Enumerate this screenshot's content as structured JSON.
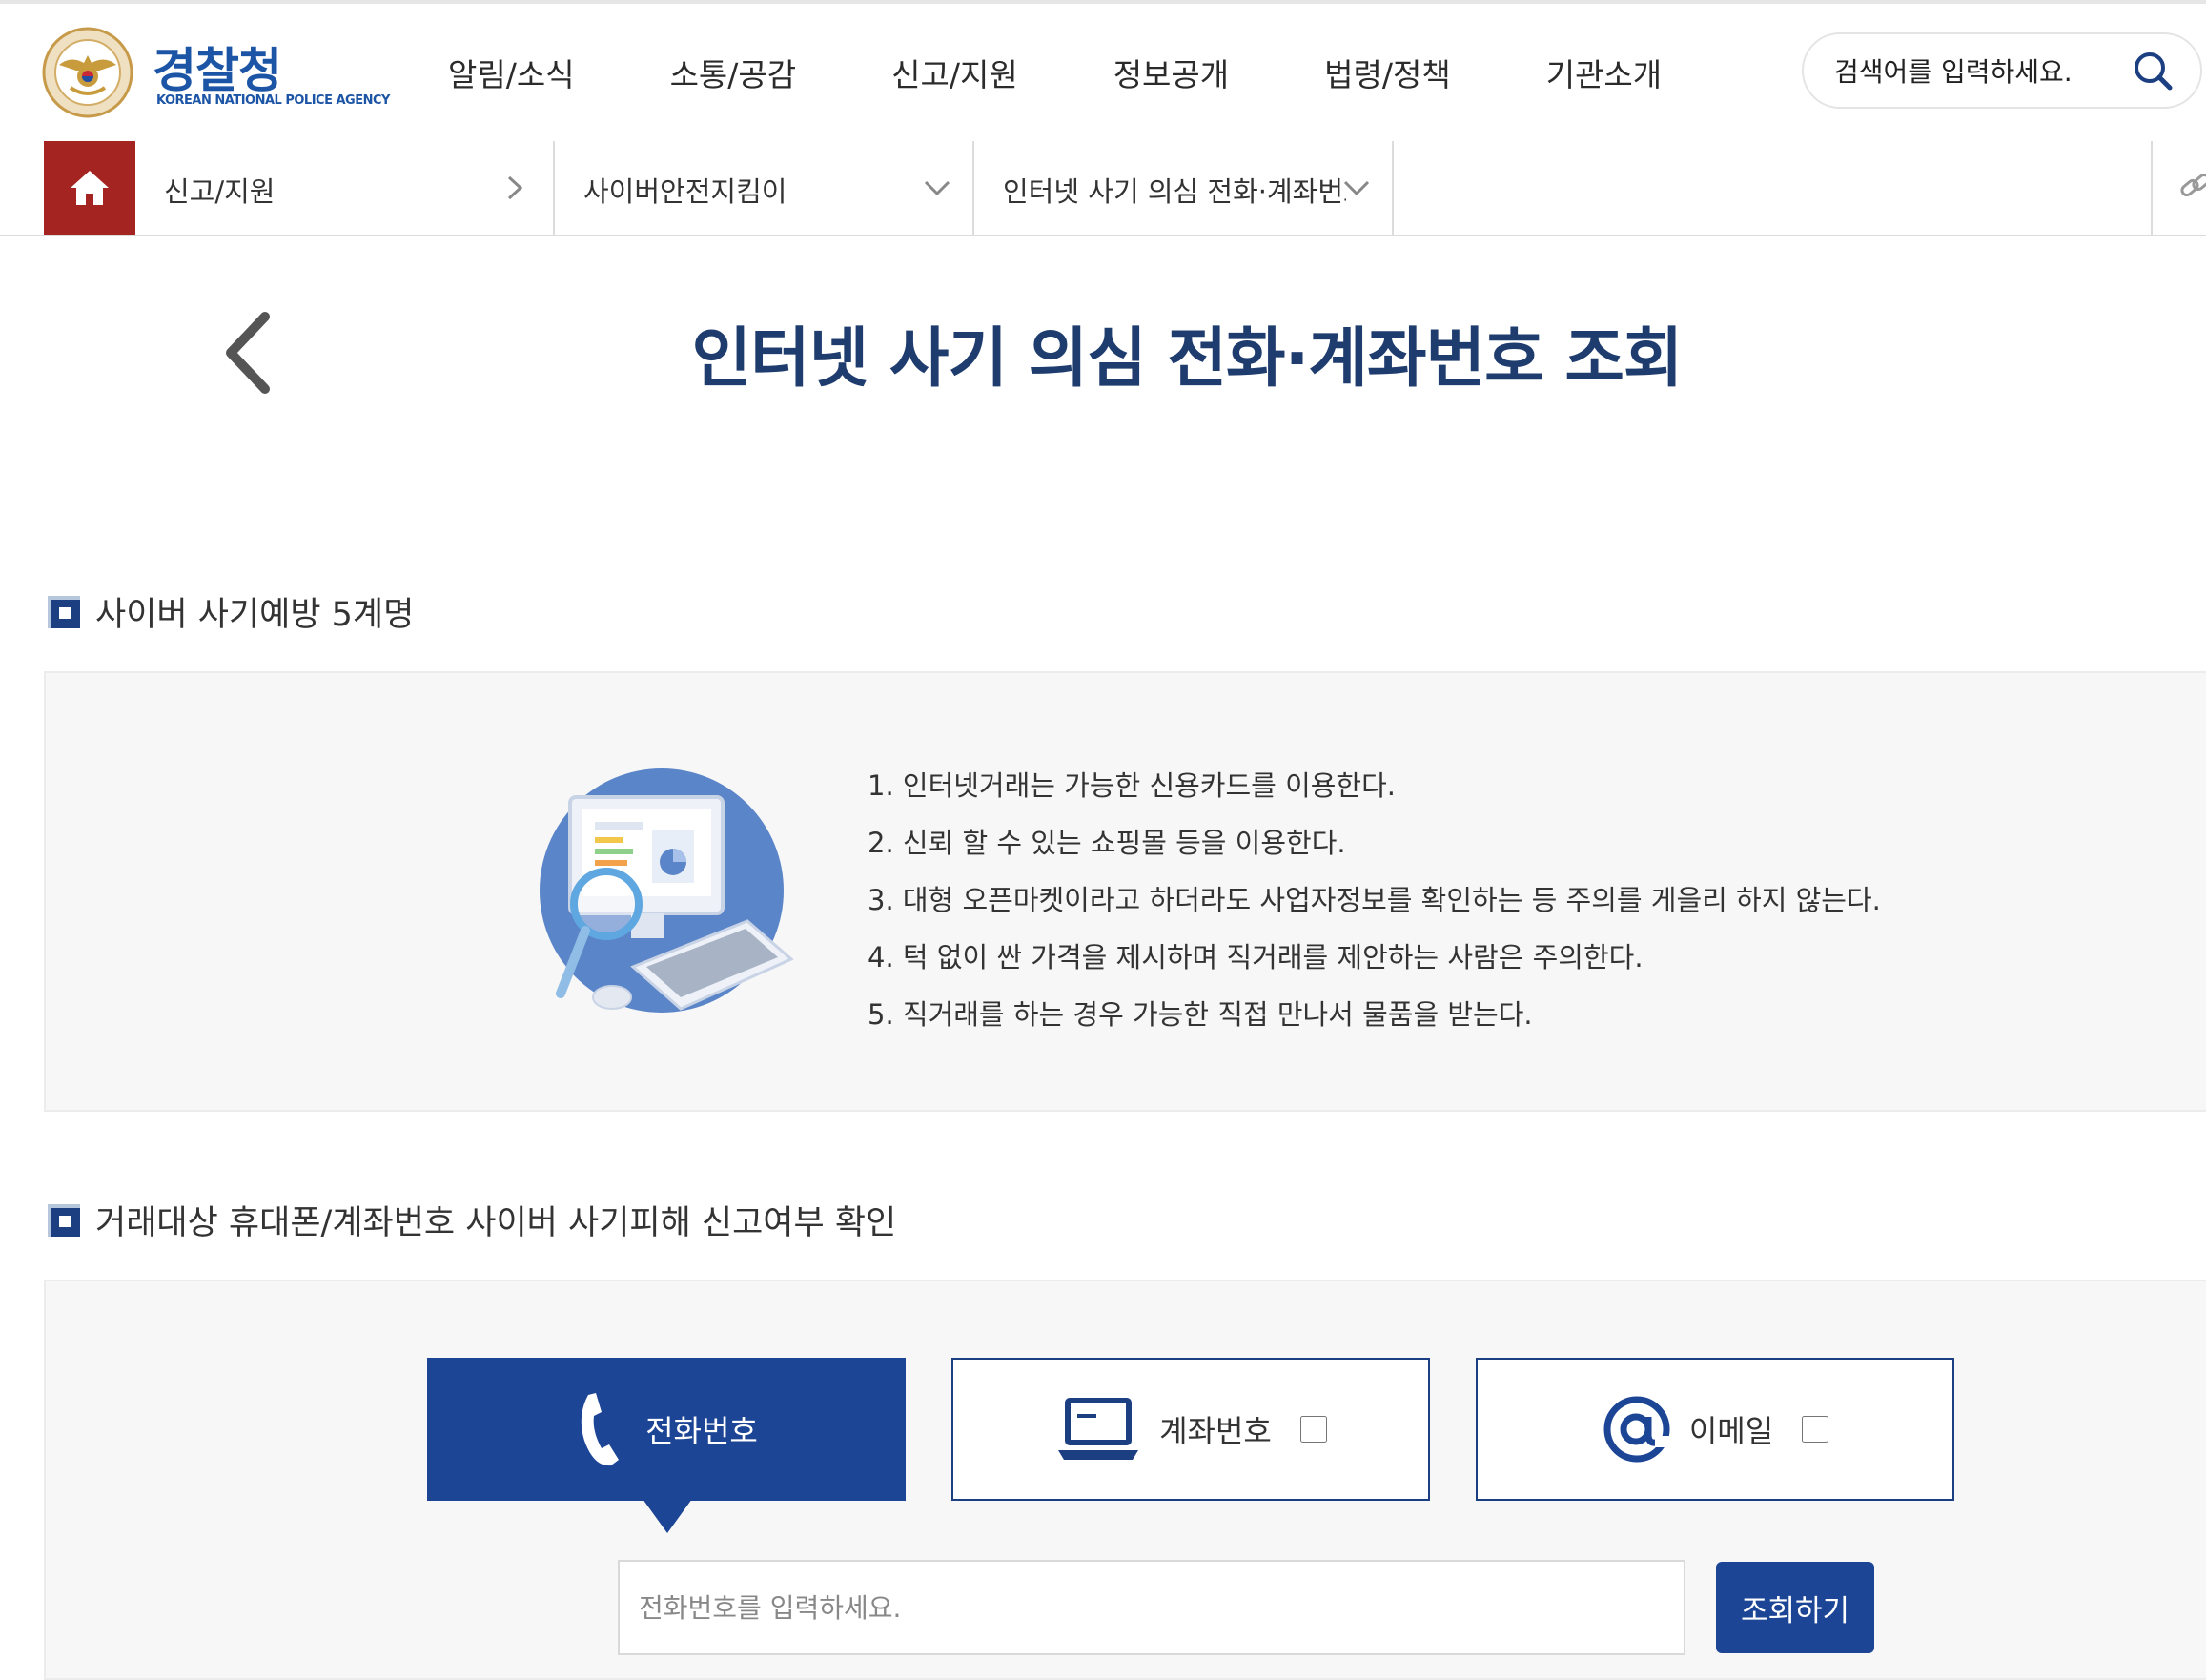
{
  "header": {
    "logo_title": "경찰청",
    "logo_subtitle": "KOREAN NATIONAL POLICE AGENCY",
    "nav": [
      "알림/소식",
      "소통/공감",
      "신고/지원",
      "정보공개",
      "법령/정책",
      "기관소개"
    ],
    "search_placeholder": "검색어를 입력하세요."
  },
  "breadcrumb": {
    "items": [
      "신고/지원",
      "사이버안전지킴이",
      "인터넷 사기 의심 전화·계좌번호 조회"
    ]
  },
  "page": {
    "title": "인터넷 사기 의심 전화·계좌번호 조회"
  },
  "prevention": {
    "title": "사이버 사기예방 5계명",
    "rules": [
      "1. 인터넷거래는 가능한 신용카드를 이용한다.",
      "2. 신뢰 할 수 있는 쇼핑몰 등을 이용한다.",
      "3. 대형 오픈마켓이라고 하더라도 사업자정보를 확인하는 등 주의를 게을리 하지 않는다.",
      "4. 턱 없이 싼 가격을 제시하며 직거래를 제안하는 사람은 주의한다.",
      "5. 직거래를 하는 경우 가능한 직접 만나서 물품을 받는다."
    ]
  },
  "lookup": {
    "title": "거래대상 휴대폰/계좌번호 사이버 사기피해 신고여부 확인",
    "tabs": [
      {
        "label": "전화번호",
        "icon": "phone-icon",
        "active": true
      },
      {
        "label": "계좌번호",
        "icon": "laptop-icon",
        "active": false
      },
      {
        "label": "이메일",
        "icon": "at-icon",
        "active": false
      }
    ],
    "input_placeholder": "전화번호를 입력하세요.",
    "submit_label": "조회하기"
  },
  "colors": {
    "primary": "#1c4596",
    "title_navy": "#1f3c6e",
    "home_red": "#a32420",
    "logo_blue": "#1d55a6"
  }
}
